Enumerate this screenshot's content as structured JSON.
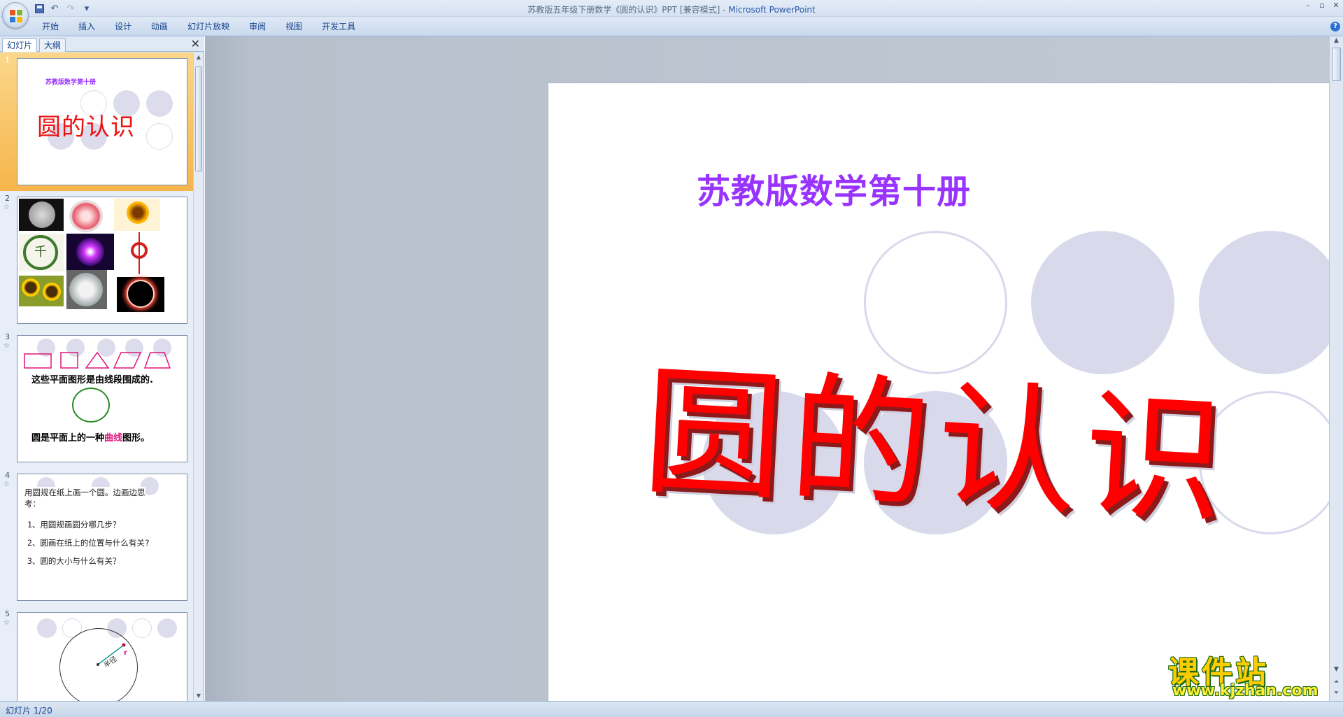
{
  "window": {
    "title_doc": "苏教版五年级下册数学《圆的认识》PPT [兼容模式] - ",
    "title_app": "Microsoft PowerPoint",
    "controls": [
      "–",
      "▫",
      "✕"
    ]
  },
  "qat": {
    "save": "save-icon",
    "undo": "undo-icon",
    "redo": "redo-icon",
    "customize": "▾"
  },
  "ribbon": {
    "tabs": [
      "开始",
      "插入",
      "设计",
      "动画",
      "幻灯片放映",
      "审阅",
      "视图",
      "开发工具"
    ],
    "help": "?"
  },
  "slides_panel": {
    "tab_slides": "幻灯片",
    "tab_outline": "大纲",
    "close": "✕",
    "thumbnails": [
      {
        "number": "1",
        "subtitle": "苏教版数学第十册",
        "title": "圆的认识",
        "selected": true
      },
      {
        "number": "2",
        "star": "☆"
      },
      {
        "number": "3",
        "star": "☆",
        "line1": "这些平面图形是由线段围成的.",
        "line2_pre": "圆是平面上的一种",
        "line2_hl": "曲线",
        "line2_post": "图形。"
      },
      {
        "number": "4",
        "star": "☆",
        "lines": [
          "用圆规在纸上画一个圆。边画边思",
          "考：",
          "1、用圆规画圆分哪几步？",
          "2、圆画在纸上的位置与什么有关?",
          "3、圆的大小与什么有关？"
        ]
      },
      {
        "number": "5",
        "star": "☆",
        "radius_label": "半径",
        "r_label": "r"
      }
    ]
  },
  "slide": {
    "subtitle": "苏教版数学第十册",
    "title": "圆的认识"
  },
  "status": {
    "slide_counter": "幻灯片 1/20"
  },
  "watermark": {
    "cn": "课件站",
    "url": "www.kjzhan.com"
  },
  "colors": {
    "subtitle": "#9933ff",
    "title": "#ff0000",
    "circle": "#d9d9ec",
    "selection": "#f6b54b"
  }
}
